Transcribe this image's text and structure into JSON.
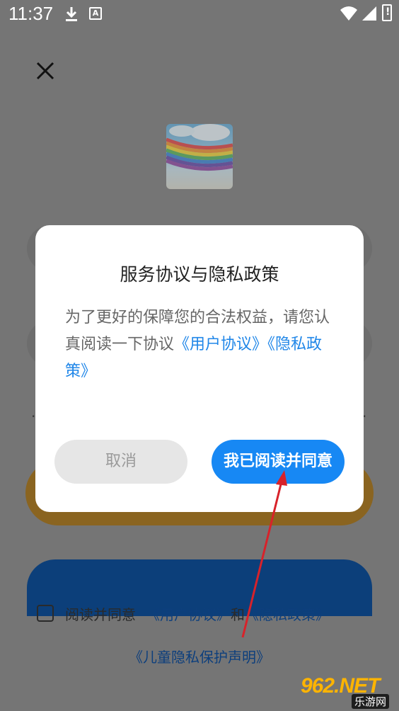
{
  "status_bar": {
    "time": "11:37"
  },
  "background": {
    "agree_prefix": "阅读并同意",
    "user_agreement": "《用户协议》",
    "and": "和",
    "privacy_policy": "《隐私政策》",
    "child_privacy": "《儿童隐私保护声明》"
  },
  "dialog": {
    "title": "服务协议与隐私政策",
    "body_text": "为了更好的保障您的合法权益，请您认真阅读一下协议",
    "link_user_agreement": "《用户协议》",
    "link_privacy_policy": "《隐私政策》",
    "cancel_label": "取消",
    "agree_label": "我已阅读并同意"
  },
  "colors": {
    "primary": "#1788f4",
    "link": "#1f86e8",
    "annotation_arrow": "#d8222a"
  },
  "watermark": {
    "brand": "962.NET",
    "sub": "乐游网"
  }
}
